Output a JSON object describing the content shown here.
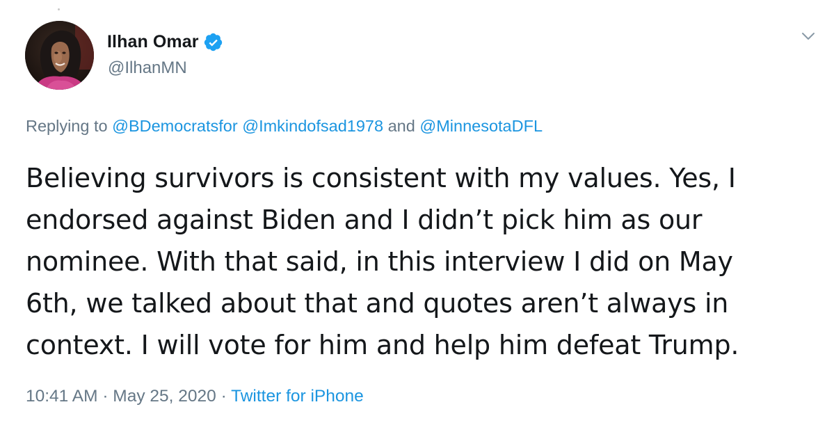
{
  "author": {
    "display_name": "Ilhan Omar",
    "handle": "@IlhanMN",
    "verified": true,
    "avatar_icon": "profile-photo"
  },
  "reply": {
    "prefix": "Replying to ",
    "mention_1": "@BDemocratsfor",
    "mention_2": "@Imkindofsad1978",
    "conjunction": " and ",
    "mention_3": "@MinnesotaDFL"
  },
  "body": {
    "lines": [
      "Believing survivors is consistent with my values. Yes, I",
      "endorsed against Biden and I didn’t pick him as our",
      "nominee. With that said, in this interview I did on May",
      "6th, we talked about that and quotes aren’t always in",
      "context. I will vote for him and help him defeat Trump."
    ]
  },
  "meta": {
    "time": "10:41 AM",
    "separator": " · ",
    "date": "May 25, 2020",
    "source": "Twitter for iPhone"
  },
  "icons": {
    "verified": "verified-badge-icon",
    "menu": "chevron-down-icon"
  },
  "colors": {
    "text": "#14171a",
    "secondary": "#657786",
    "link": "#1b95e0",
    "verified": "#1da1f2"
  }
}
